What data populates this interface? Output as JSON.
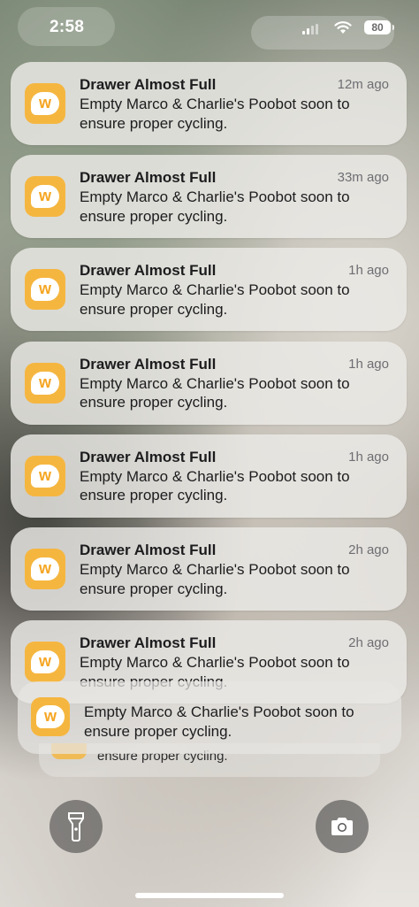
{
  "status_bar": {
    "time": "2:58",
    "battery": "80"
  },
  "notifications": [
    {
      "title": "Drawer Almost Full",
      "time": "12m ago",
      "body": "Empty Marco & Charlie's Poobot soon to ensure proper cycling."
    },
    {
      "title": "Drawer Almost Full",
      "time": "33m ago",
      "body": "Empty Marco & Charlie's Poobot soon to ensure proper cycling."
    },
    {
      "title": "Drawer Almost Full",
      "time": "1h ago",
      "body": "Empty Marco & Charlie's Poobot soon to ensure proper cycling."
    },
    {
      "title": "Drawer Almost Full",
      "time": "1h ago",
      "body": "Empty Marco & Charlie's Poobot soon to ensure proper cycling."
    },
    {
      "title": "Drawer Almost Full",
      "time": "1h ago",
      "body": "Empty Marco & Charlie's Poobot soon to ensure proper cycling."
    },
    {
      "title": "Drawer Almost Full",
      "time": "2h ago",
      "body": "Empty Marco & Charlie's Poobot soon to ensure proper cycling."
    },
    {
      "title": "Drawer Almost Full",
      "time": "2h ago",
      "body": "Empty Marco & Charlie's Poobot soon to ensure proper cycling."
    }
  ],
  "stacked": {
    "first_body": "Empty Marco & Charlie's Poobot soon to ensure proper cycling.",
    "second_body": "ensure proper cycling."
  },
  "app_icon_letter": "w",
  "colors": {
    "app_icon": "#f5b640",
    "card_bg": "#eceae7"
  },
  "icons": {
    "left_button": "flashlight-icon",
    "right_button": "camera-icon"
  }
}
